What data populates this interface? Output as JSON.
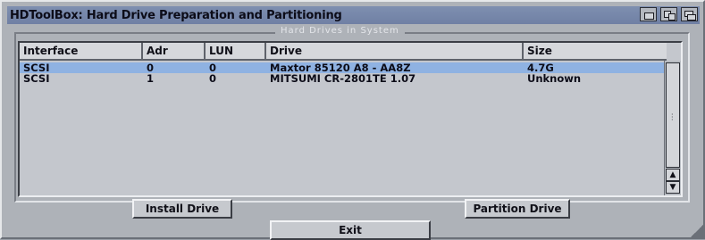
{
  "window": {
    "title": "HDToolBox: Hard Drive Preparation and Partitioning",
    "group_title": "Hard Drives in System"
  },
  "list": {
    "columns": [
      "Interface",
      "Adr",
      "LUN",
      "Drive",
      "Size"
    ],
    "rows": [
      {
        "interface": "SCSI",
        "adr": "0",
        "lun": "0",
        "drive": "Maxtor 85120 A8 -  AA8Z",
        "size": "4.7G",
        "selected": true
      },
      {
        "interface": "SCSI",
        "adr": "1",
        "lun": "0",
        "drive": "MITSUMI CR-2801TE   1.07",
        "size": "Unknown",
        "selected": false
      }
    ]
  },
  "buttons": {
    "install": "Install Drive",
    "partition": "Partition Drive",
    "exit": "Exit"
  },
  "icons": {
    "scroll_up": "▲",
    "scroll_down": "▼"
  },
  "colors": {
    "titlebar": "#7080a4",
    "selection": "#8fb2e2",
    "window_bg": "#aeb2b8"
  }
}
